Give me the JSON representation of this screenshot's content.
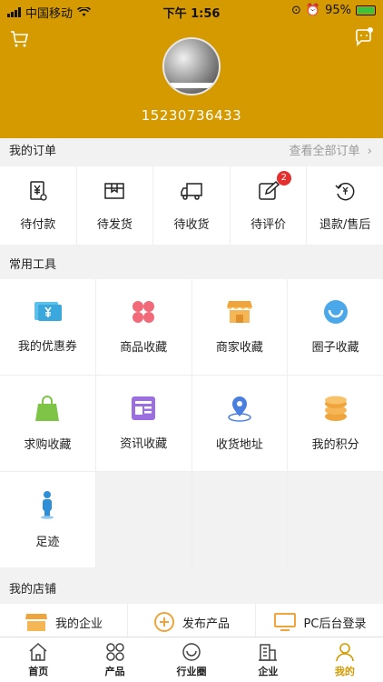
{
  "status_bar": {
    "carrier": "中国移动",
    "time": "下午 1:56",
    "battery": "95%"
  },
  "profile": {
    "phone": "15230736433"
  },
  "orders": {
    "title": "我的订单",
    "view_all": "查看全部订单",
    "items": [
      {
        "label": "待付款",
        "icon": "yen-receipt-icon"
      },
      {
        "label": "待发货",
        "icon": "package-icon"
      },
      {
        "label": "待收货",
        "icon": "truck-icon"
      },
      {
        "label": "待评价",
        "icon": "edit-icon",
        "badge": "2"
      },
      {
        "label": "退款/售后",
        "icon": "refund-icon"
      }
    ]
  },
  "tools": {
    "title": "常用工具",
    "items": [
      {
        "label": "我的优惠券",
        "icon": "coupon-icon"
      },
      {
        "label": "商品收藏",
        "icon": "clover-icon"
      },
      {
        "label": "商家收藏",
        "icon": "store-icon"
      },
      {
        "label": "圈子收藏",
        "icon": "smile-circle-icon"
      },
      {
        "label": "求购收藏",
        "icon": "shopping-bag-icon"
      },
      {
        "label": "资讯收藏",
        "icon": "news-icon"
      },
      {
        "label": "收货地址",
        "icon": "location-pin-icon"
      },
      {
        "label": "我的积分",
        "icon": "coins-icon"
      },
      {
        "label": "足迹",
        "icon": "footprint-person-icon"
      }
    ]
  },
  "shop": {
    "title": "我的店铺",
    "items": [
      {
        "label": "我的企业",
        "icon": "store-icon"
      },
      {
        "label": "发布产品",
        "icon": "plus-circle-icon"
      },
      {
        "label": "PC后台登录",
        "icon": "monitor-icon"
      }
    ]
  },
  "tabbar": [
    {
      "label": "首页",
      "icon": "home-icon"
    },
    {
      "label": "产品",
      "icon": "grid-icon"
    },
    {
      "label": "行业圈",
      "icon": "circle-icon"
    },
    {
      "label": "企业",
      "icon": "building-icon"
    },
    {
      "label": "我的",
      "icon": "person-icon"
    }
  ],
  "colors": {
    "brand": "#d49a00",
    "badge": "#e53030"
  }
}
